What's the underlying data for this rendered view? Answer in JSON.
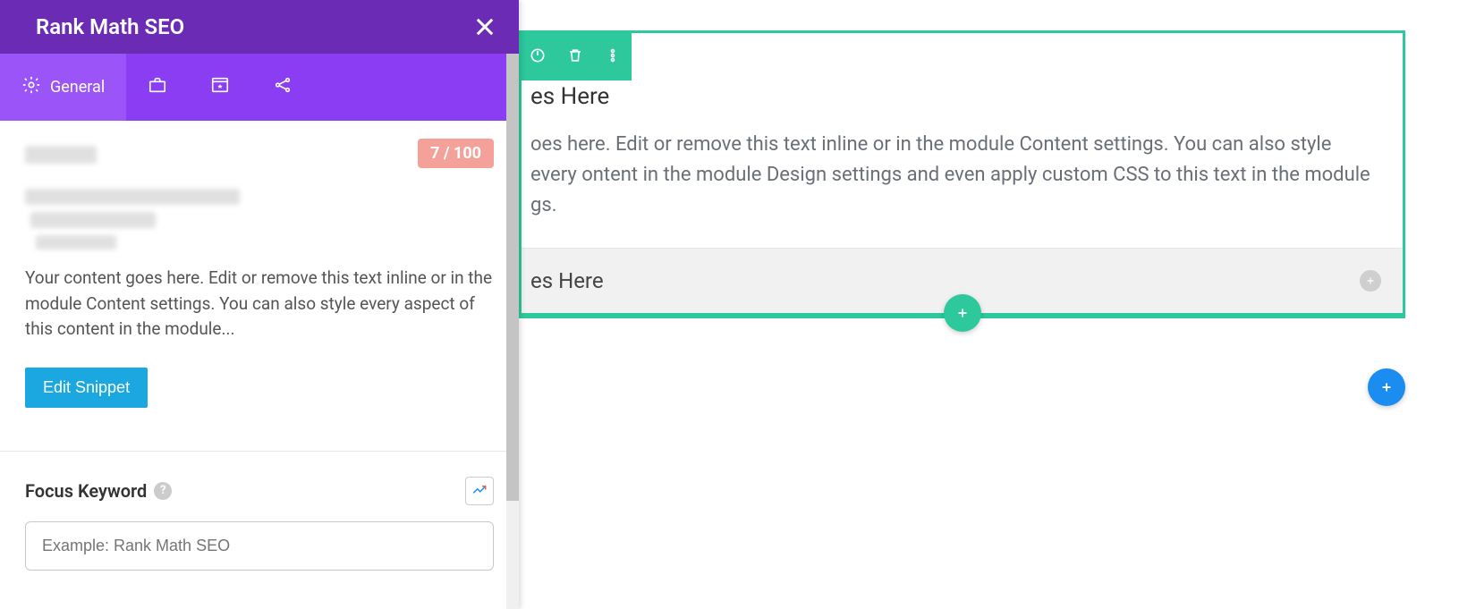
{
  "panel": {
    "title": "Rank Math SEO",
    "tabs": {
      "general": "General"
    },
    "score": "7 / 100",
    "snippet_desc": "Your content goes here. Edit or remove this text inline or in the module Content settings. You can also style every aspect of this content in the module...",
    "edit_snippet_label": "Edit Snippet",
    "focus_keyword": {
      "label": "Focus Keyword",
      "placeholder": "Example: Rank Math SEO"
    }
  },
  "builder": {
    "module1": {
      "title": "es Here",
      "text": "oes here. Edit or remove this text inline or in the module Content settings. You can also style every ontent in the module Design settings and even apply custom CSS to this text in the module gs."
    },
    "module2": {
      "title": "es Here"
    }
  }
}
